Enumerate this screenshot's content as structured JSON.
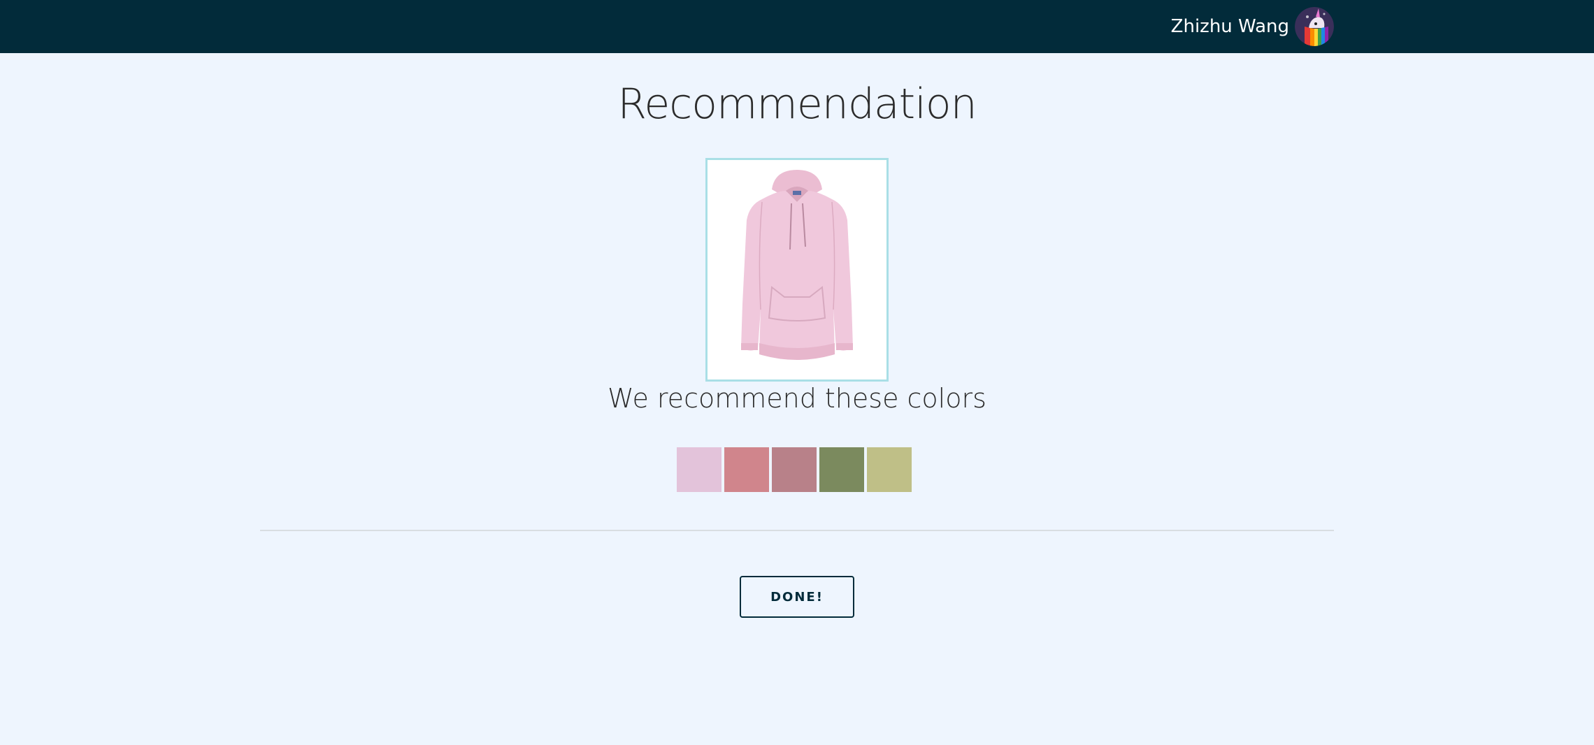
{
  "header": {
    "user_name": "Zhizhu Wang",
    "avatar_icon": "unicorn-rainbow-avatar"
  },
  "main": {
    "title": "Recommendation",
    "product_image_icon": "pink-hoodie-image",
    "subtitle": "We recommend these colors",
    "recommended_colors": [
      "#e3c3da",
      "#d0858c",
      "#b88189",
      "#7b8a5e",
      "#bfbf87"
    ],
    "done_label": "DONE!"
  },
  "colors": {
    "topbar": "#022b3a",
    "background": "#eef5fe",
    "frame_border": "#a9dfe6",
    "hoodie": "#f0c8dc"
  }
}
